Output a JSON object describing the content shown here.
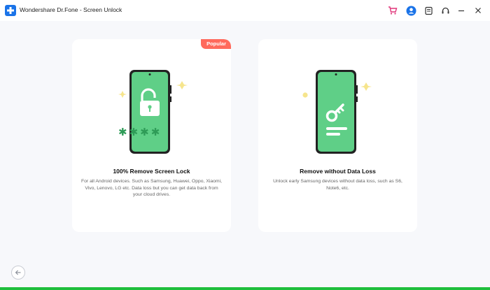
{
  "window": {
    "title": "Wondershare Dr.Fone - Screen Unlock"
  },
  "header_icons": [
    {
      "name": "cart-icon",
      "color": "#e0357a"
    },
    {
      "name": "account-icon",
      "color": "#1a73e8"
    },
    {
      "name": "feedback-icon",
      "color": "#333333"
    },
    {
      "name": "support-icon",
      "color": "#333333"
    },
    {
      "name": "minimize-icon",
      "color": "#333333"
    },
    {
      "name": "close-icon",
      "color": "#333333"
    }
  ],
  "options": [
    {
      "badge": "Popular",
      "title": "100% Remove Screen Lock",
      "description": "For all Android devices. Such as Samsung, Huawei, Oppo, Xiaomi, Vivo, Lenovo, LG etc. Data loss but you can get data back from your cloud drives.",
      "illustration": "phone-unlock-icon",
      "password_mask": "✱✱✱✱"
    },
    {
      "title": "Remove without Data Loss",
      "description": "Unlock early Samsung devices without data loss, such as S6, Note6, etc.",
      "illustration": "phone-key-icon"
    }
  ],
  "colors": {
    "accent": "#1a73e8",
    "phone_screen": "#5fcf87",
    "badge": "#ff6a5c",
    "star": "#f6e58d",
    "progress": "#1fbf3c"
  },
  "navigation": {
    "back_icon": "back-arrow-icon"
  }
}
